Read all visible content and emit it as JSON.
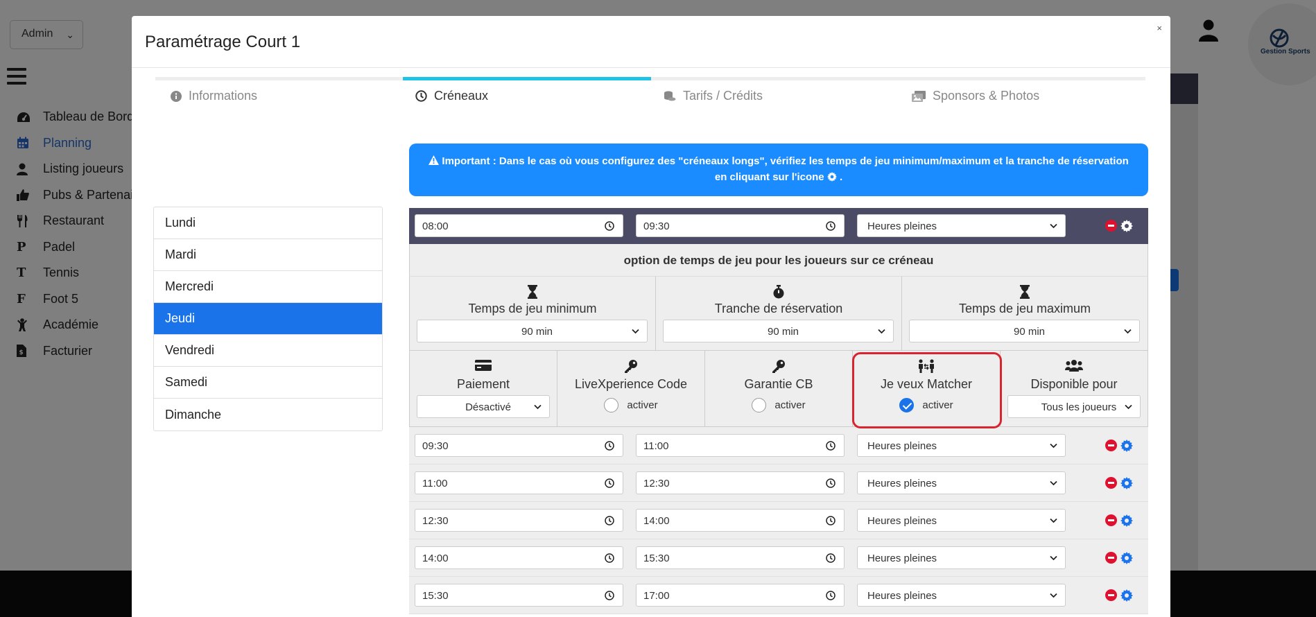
{
  "background": {
    "role_select": "Admin",
    "nav": [
      {
        "label": "Tableau de Bord",
        "icon": "dashboard-icon",
        "active": false
      },
      {
        "label": "Planning",
        "icon": "calendar-icon",
        "active": true
      },
      {
        "label": "Listing joueurs",
        "icon": "user-icon",
        "active": false
      },
      {
        "label": "Pubs & Partenair",
        "icon": "thumbs-up-icon",
        "active": false
      },
      {
        "label": "Restaurant",
        "icon": "utensils-icon",
        "active": false
      },
      {
        "label": "Padel",
        "icon": "letter-p-icon",
        "active": false
      },
      {
        "label": "Tennis",
        "icon": "letter-t-icon",
        "active": false
      },
      {
        "label": "Foot 5",
        "icon": "letter-f-icon",
        "active": false
      },
      {
        "label": "Académie",
        "icon": "child-icon",
        "active": false
      },
      {
        "label": "Facturier",
        "icon": "invoice-icon",
        "active": false
      }
    ],
    "logo_text": "Gestion Sports"
  },
  "modal": {
    "title": "Paramétrage Court 1",
    "close": "×",
    "tabs": [
      {
        "label": "Informations",
        "icon": "info-circle-icon",
        "active": false
      },
      {
        "label": "Créneaux",
        "icon": "clock-icon",
        "active": true
      },
      {
        "label": "Tarifs / Crédits",
        "icon": "coins-icon",
        "active": false
      },
      {
        "label": "Sponsors & Photos",
        "icon": "images-icon",
        "active": false
      }
    ],
    "days": [
      {
        "label": "Lundi",
        "active": false
      },
      {
        "label": "Mardi",
        "active": false
      },
      {
        "label": "Mercredi",
        "active": false
      },
      {
        "label": "Jeudi",
        "active": true
      },
      {
        "label": "Vendredi",
        "active": false
      },
      {
        "label": "Samedi",
        "active": false
      },
      {
        "label": "Dimanche",
        "active": false
      }
    ],
    "alert": {
      "strong": "Important :",
      "text1": "Dans le cas où vous configurez des \"créneaux longs\", vérifiez les temps de jeu minimum/maximum et la tranche de réservation",
      "text2": "en cliquant sur l'icone",
      "text3": "."
    },
    "first_slot": {
      "start": "08:00",
      "end": "09:30",
      "type": "Heures pleines"
    },
    "options": {
      "title": "option de temps de jeu pour les joueurs sur ce créneau",
      "min": {
        "label": "Temps de jeu minimum",
        "value": "90 min"
      },
      "tranche": {
        "label": "Tranche de réservation",
        "value": "90 min"
      },
      "max": {
        "label": "Temps de jeu maximum",
        "value": "90 min"
      }
    },
    "features": {
      "paiement": {
        "label": "Paiement",
        "value": "Désactivé"
      },
      "livexperience": {
        "label": "LiveXperience Code",
        "radio": "activer",
        "checked": false
      },
      "garantie": {
        "label": "Garantie CB",
        "radio": "activer",
        "checked": false
      },
      "matcher": {
        "label": "Je veux Matcher",
        "radio": "activer",
        "checked": true
      },
      "disponible": {
        "label": "Disponible pour",
        "value": "Tous les joueurs"
      }
    },
    "slots": [
      {
        "start": "09:30",
        "end": "11:00",
        "type": "Heures pleines"
      },
      {
        "start": "11:00",
        "end": "12:30",
        "type": "Heures pleines"
      },
      {
        "start": "12:30",
        "end": "14:00",
        "type": "Heures pleines"
      },
      {
        "start": "14:00",
        "end": "15:30",
        "type": "Heures pleines"
      },
      {
        "start": "15:30",
        "end": "17:00",
        "type": "Heures pleines"
      }
    ]
  }
}
